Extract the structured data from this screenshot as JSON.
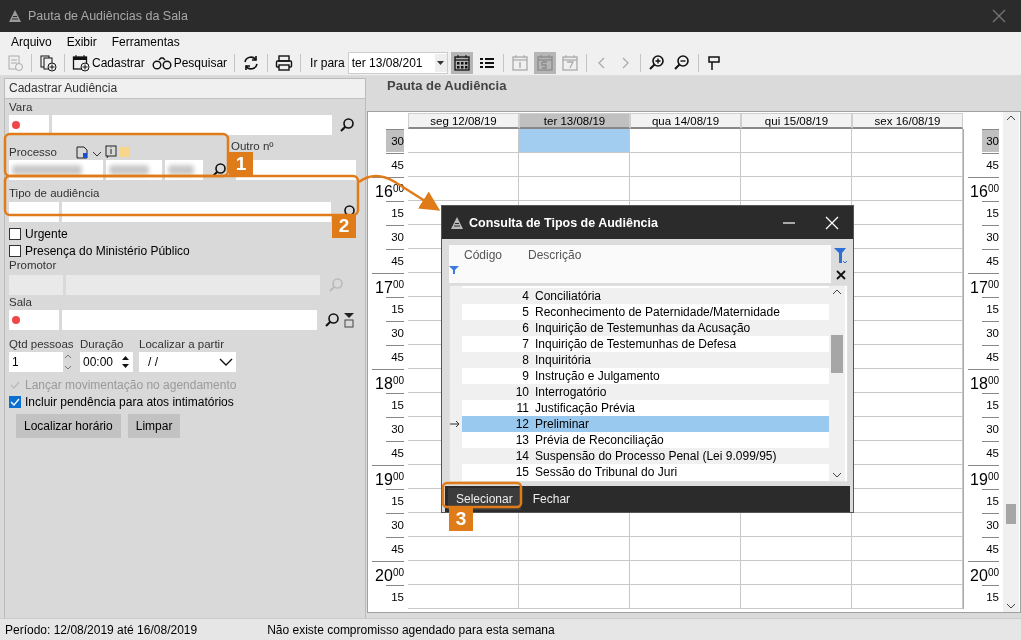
{
  "window": {
    "title": "Pauta de Audiências da Sala"
  },
  "menu": [
    {
      "label": "Arquivo"
    },
    {
      "label": "Exibir"
    },
    {
      "label": "Ferramentas"
    }
  ],
  "toolbar": {
    "left": [
      {
        "disabled": true
      },
      {
        "disabled": false
      },
      {
        "label": "Cadastrar",
        "disabled": false
      },
      {
        "label": "Pesquisar",
        "disabled": false
      },
      {
        "disabled": false
      },
      {
        "disabled": false
      }
    ],
    "goto_label": "Ir para",
    "goto_date": "ter 13/08/201",
    "right": [
      {
        "selected": true,
        "disabled": false
      },
      {
        "selected": false,
        "disabled": false
      },
      {
        "selected": false,
        "disabled": true
      },
      {
        "selected": true,
        "disabled": true
      },
      {
        "selected": false,
        "disabled": true
      },
      {
        "selected": false,
        "disabled": true
      },
      {
        "selected": false,
        "disabled": true
      },
      {
        "selected": false,
        "disabled": false
      },
      {
        "selected": false,
        "disabled": false
      },
      {
        "selected": false,
        "disabled": false
      }
    ]
  },
  "form": {
    "title": "Cadastrar Audiência",
    "vara": {
      "label": "Vara",
      "required": true
    },
    "processo": {
      "label": "Processo",
      "other_label": "Outro nº"
    },
    "tipo": {
      "label": "Tipo de audiência"
    },
    "checks": [
      {
        "label": "Urgente",
        "checked": false
      },
      {
        "label": "Presença do Ministério Público",
        "checked": false
      }
    ],
    "promotor": {
      "label": "Promotor",
      "disabled": true
    },
    "sala": {
      "label": "Sala",
      "required": true
    },
    "qtd": {
      "label": "Qtd pessoas",
      "value": "1"
    },
    "duracao": {
      "label": "Duração",
      "value": "00:00"
    },
    "localizar": {
      "label": "Localizar a partir",
      "value": "/ /"
    },
    "options": [
      {
        "label": "Lançar movimentação no agendamento",
        "checked": true,
        "disabled": true
      },
      {
        "label": "Incluir pendência para atos intimatórios",
        "checked": true,
        "disabled": false
      }
    ],
    "buttons": [
      {
        "label": "Localizar horário"
      },
      {
        "label": "Limpar"
      }
    ]
  },
  "schedule": {
    "title": "Pauta de Audiência",
    "days": [
      {
        "label": "seg 12/08/19",
        "selected": false
      },
      {
        "label": "ter 13/08/19",
        "selected": true
      },
      {
        "label": "qua 14/08/19",
        "selected": false
      },
      {
        "label": "qui 15/08/19",
        "selected": false
      },
      {
        "label": "sex 16/08/19",
        "selected": false
      }
    ],
    "left_times": [
      {
        "minute": "30",
        "selected": true
      },
      {
        "minute": "45",
        "selected": false
      },
      {
        "hour": "16",
        "minute": "00",
        "selected": false
      },
      {
        "minute": "15",
        "selected": false
      },
      {
        "minute": "30",
        "selected": false
      },
      {
        "minute": "45",
        "selected": false
      },
      {
        "hour": "17",
        "minute": "00",
        "selected": false
      },
      {
        "minute": "15",
        "selected": false
      },
      {
        "minute": "30",
        "selected": false
      },
      {
        "minute": "45",
        "selected": false
      },
      {
        "hour": "18",
        "minute": "00",
        "selected": false
      },
      {
        "minute": "15",
        "selected": false
      },
      {
        "minute": "30",
        "selected": false
      },
      {
        "minute": "45",
        "selected": false
      },
      {
        "hour": "19",
        "minute": "00",
        "selected": false
      },
      {
        "minute": "15",
        "selected": false
      },
      {
        "minute": "30",
        "selected": false
      },
      {
        "minute": "45",
        "selected": false
      },
      {
        "hour": "20",
        "minute": "00",
        "selected": false
      },
      {
        "minute": "15",
        "selected": false
      }
    ],
    "right_times": [
      {
        "minute": "30",
        "selected": true
      },
      {
        "minute": "45",
        "selected": false
      },
      {
        "hour": "16",
        "minute": "00",
        "selected": false
      },
      {
        "minute": "15",
        "selected": false
      },
      {
        "minute": "30",
        "selected": false
      },
      {
        "minute": "45",
        "selected": false
      },
      {
        "hour": "17",
        "minute": "00",
        "selected": false
      },
      {
        "minute": "15",
        "selected": false
      },
      {
        "minute": "30",
        "selected": false
      },
      {
        "minute": "45",
        "selected": false
      },
      {
        "hour": "18",
        "minute": "00",
        "selected": false
      },
      {
        "minute": "15",
        "selected": false
      },
      {
        "minute": "30",
        "selected": false
      },
      {
        "minute": "45",
        "selected": false
      },
      {
        "hour": "19",
        "minute": "00",
        "selected": false
      },
      {
        "minute": "15",
        "selected": false
      },
      {
        "minute": "30",
        "selected": false
      },
      {
        "minute": "45",
        "selected": false
      },
      {
        "hour": "20",
        "minute": "00",
        "selected": false
      },
      {
        "minute": "15",
        "selected": false
      }
    ]
  },
  "dialog": {
    "title": "Consulta de Tipos de Audiência",
    "columns": [
      "Código",
      "Descrição"
    ],
    "rows": [
      {
        "code": "4",
        "description": "Conciliatória",
        "selected": false
      },
      {
        "code": "5",
        "description": "Reconhecimento de Paternidade/Maternidade",
        "selected": false
      },
      {
        "code": "6",
        "description": "Inquirição de Testemunhas da Acusação",
        "selected": false
      },
      {
        "code": "7",
        "description": "Inquirição de Testemunhas de Defesa",
        "selected": false
      },
      {
        "code": "8",
        "description": "Inquiritória",
        "selected": false
      },
      {
        "code": "9",
        "description": "Instrução e Julgamento",
        "selected": false
      },
      {
        "code": "10",
        "description": "Interrogatório",
        "selected": false
      },
      {
        "code": "11",
        "description": "Justificação Prévia",
        "selected": false
      },
      {
        "code": "12",
        "description": "Preliminar",
        "selected": true
      },
      {
        "code": "13",
        "description": "Prévia de Reconciliação",
        "selected": false
      },
      {
        "code": "14",
        "description": "Suspensão do Processo Penal (Lei 9.099/95)",
        "selected": false
      },
      {
        "code": "15",
        "description": "Sessão do Tribunal do Juri",
        "selected": false
      }
    ],
    "buttons": [
      {
        "label": "Selecionar",
        "focused": true
      },
      {
        "label": "Fechar",
        "focused": false
      }
    ]
  },
  "annotations": [
    {
      "label": "1"
    },
    {
      "label": "2"
    },
    {
      "label": "3"
    }
  ],
  "status_bar": {
    "period": "Período: 12/08/2019 até 16/08/2019",
    "message": "Não existe compromisso agendado para esta semana"
  }
}
